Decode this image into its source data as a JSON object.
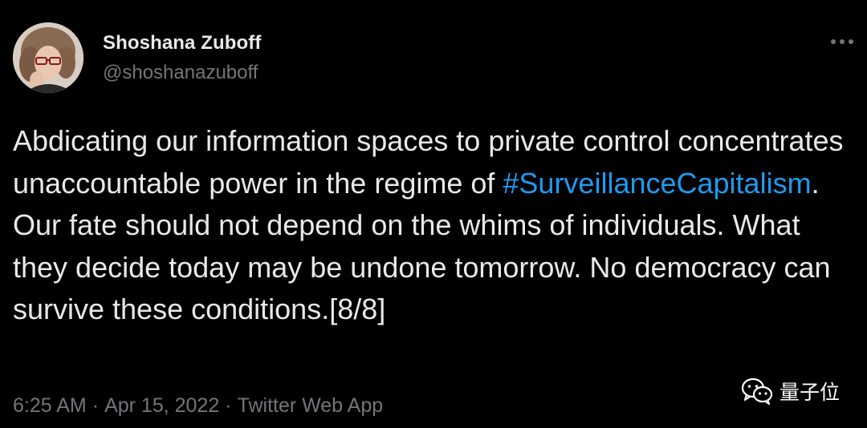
{
  "author": {
    "name": "Shoshana Zuboff",
    "handle": "@shoshanazuboff"
  },
  "tweet": {
    "text_before": "Abdicating our information spaces to private control concentrates unaccountable power in the regime of ",
    "hashtag": "#SurveillanceCapitalism",
    "text_after": ". Our fate should not depend on the whims of individuals. What they decide today may be undone tomorrow. No democracy can survive these conditions.[8/8]"
  },
  "meta": {
    "time": "6:25 AM",
    "separator": "·",
    "date": "Apr 15, 2022",
    "source": "Twitter Web App"
  },
  "watermark": {
    "text": "量子位",
    "icon": "wechat-icon"
  },
  "icons": {
    "more": "more-options-icon",
    "avatar": "profile-photo"
  },
  "colors": {
    "background": "#000000",
    "text": "#e7e9ea",
    "secondary_text": "#71767b",
    "link": "#1d9bf0"
  }
}
